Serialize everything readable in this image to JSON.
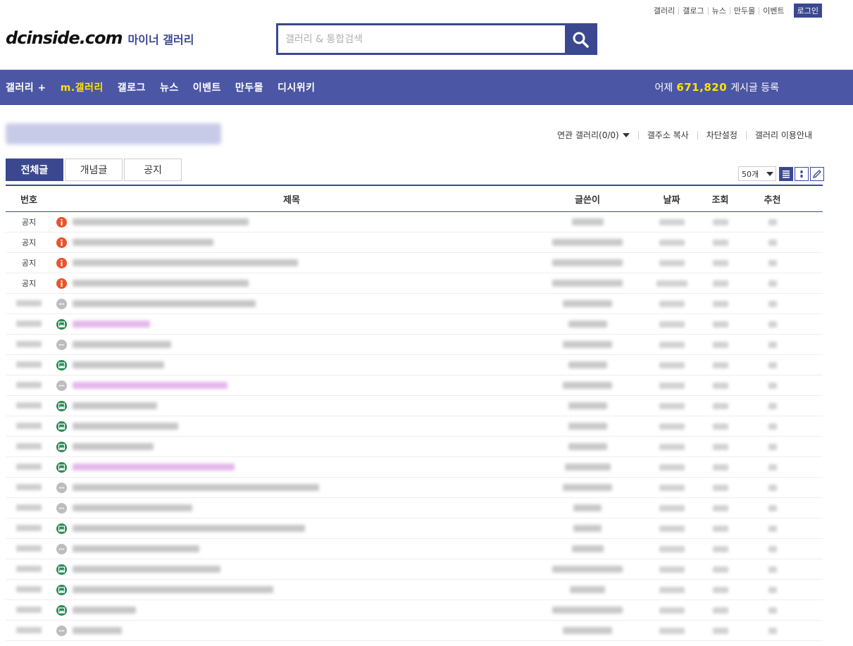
{
  "top_links": [
    "갤러리",
    "갤로그",
    "뉴스",
    "만두몰",
    "이벤트"
  ],
  "login_label": "로그인",
  "logo": {
    "brand": "dcinside.com",
    "sub": "마이너 갤러리"
  },
  "search": {
    "placeholder": "갤러리 & 통합검색",
    "icon": "search-icon"
  },
  "nav": {
    "items": [
      "갤러리 +",
      "m.갤러리",
      "갤로그",
      "뉴스",
      "이벤트",
      "만두몰",
      "디시위키"
    ],
    "active_index": 1,
    "stat_prefix": "어제",
    "stat_count": "671,820",
    "stat_suffix": "게시글 등록"
  },
  "gallery_links": [
    "연관 갤러리(0/0)",
    "갤주소 복사",
    "차단설정",
    "갤러리 이용안내"
  ],
  "tabs": [
    "전체글",
    "개념글",
    "공지"
  ],
  "list_size": "50개",
  "table": {
    "headers": {
      "no": "번호",
      "title": "제목",
      "writer": "글쓴이",
      "date": "날짜",
      "views": "조회",
      "recommend": "추천"
    },
    "rows": [
      {
        "no": "공지",
        "type": "notice"
      },
      {
        "no": "공지",
        "type": "notice"
      },
      {
        "no": "공지",
        "type": "notice"
      },
      {
        "no": "공지",
        "type": "notice"
      },
      {
        "no": "",
        "type": "txt"
      },
      {
        "no": "",
        "type": "img"
      },
      {
        "no": "",
        "type": "txt"
      },
      {
        "no": "",
        "type": "img"
      },
      {
        "no": "",
        "type": "txt"
      },
      {
        "no": "",
        "type": "img"
      },
      {
        "no": "",
        "type": "img"
      },
      {
        "no": "",
        "type": "img"
      },
      {
        "no": "",
        "type": "img"
      },
      {
        "no": "",
        "type": "txt"
      },
      {
        "no": "",
        "type": "txt"
      },
      {
        "no": "",
        "type": "img"
      },
      {
        "no": "",
        "type": "txt"
      },
      {
        "no": "",
        "type": "img"
      },
      {
        "no": "",
        "type": "img"
      },
      {
        "no": "",
        "type": "img"
      },
      {
        "no": "",
        "type": "txt"
      }
    ]
  },
  "colors": {
    "brand": "#3b4890",
    "nav_bg": "#4b56a4",
    "highlight": "#ffe400",
    "notice": "#e9542c",
    "image_post": "#2a8a55"
  }
}
